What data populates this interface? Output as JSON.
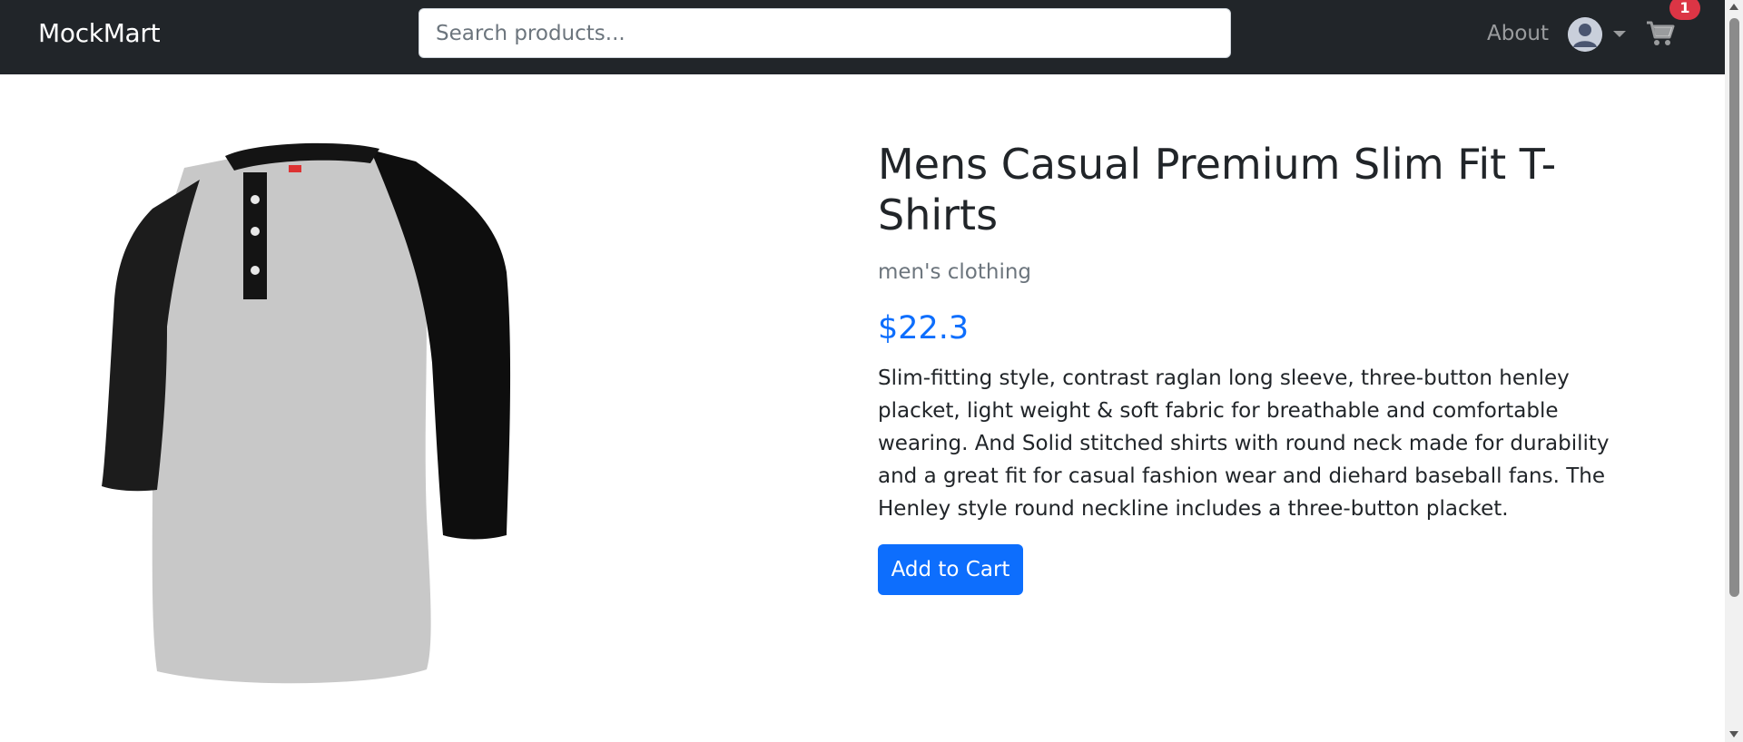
{
  "navbar": {
    "brand": "MockMart",
    "search_placeholder": "Search products...",
    "about_label": "About",
    "avatar_icon": "user-avatar-icon",
    "dropdown_icon": "caret-down-icon",
    "cart_icon": "shopping-cart-icon",
    "cart_count": "1"
  },
  "product": {
    "title": "Mens Casual Premium Slim Fit T-Shirts",
    "category": "men's clothing",
    "price": "$22.3",
    "description": "Slim-fitting style, contrast raglan long sleeve, three-button henley placket, light weight & soft fabric for breathable and comfortable wearing. And Solid stitched shirts with round neck made for durability and a great fit for casual fashion wear and diehard baseball fans. The Henley style round neckline includes a three-button placket.",
    "add_to_cart_label": "Add to Cart"
  },
  "colors": {
    "navbar_bg": "#212529",
    "accent": "#0d6efd",
    "badge": "#dc3545",
    "muted": "#6c757d"
  }
}
